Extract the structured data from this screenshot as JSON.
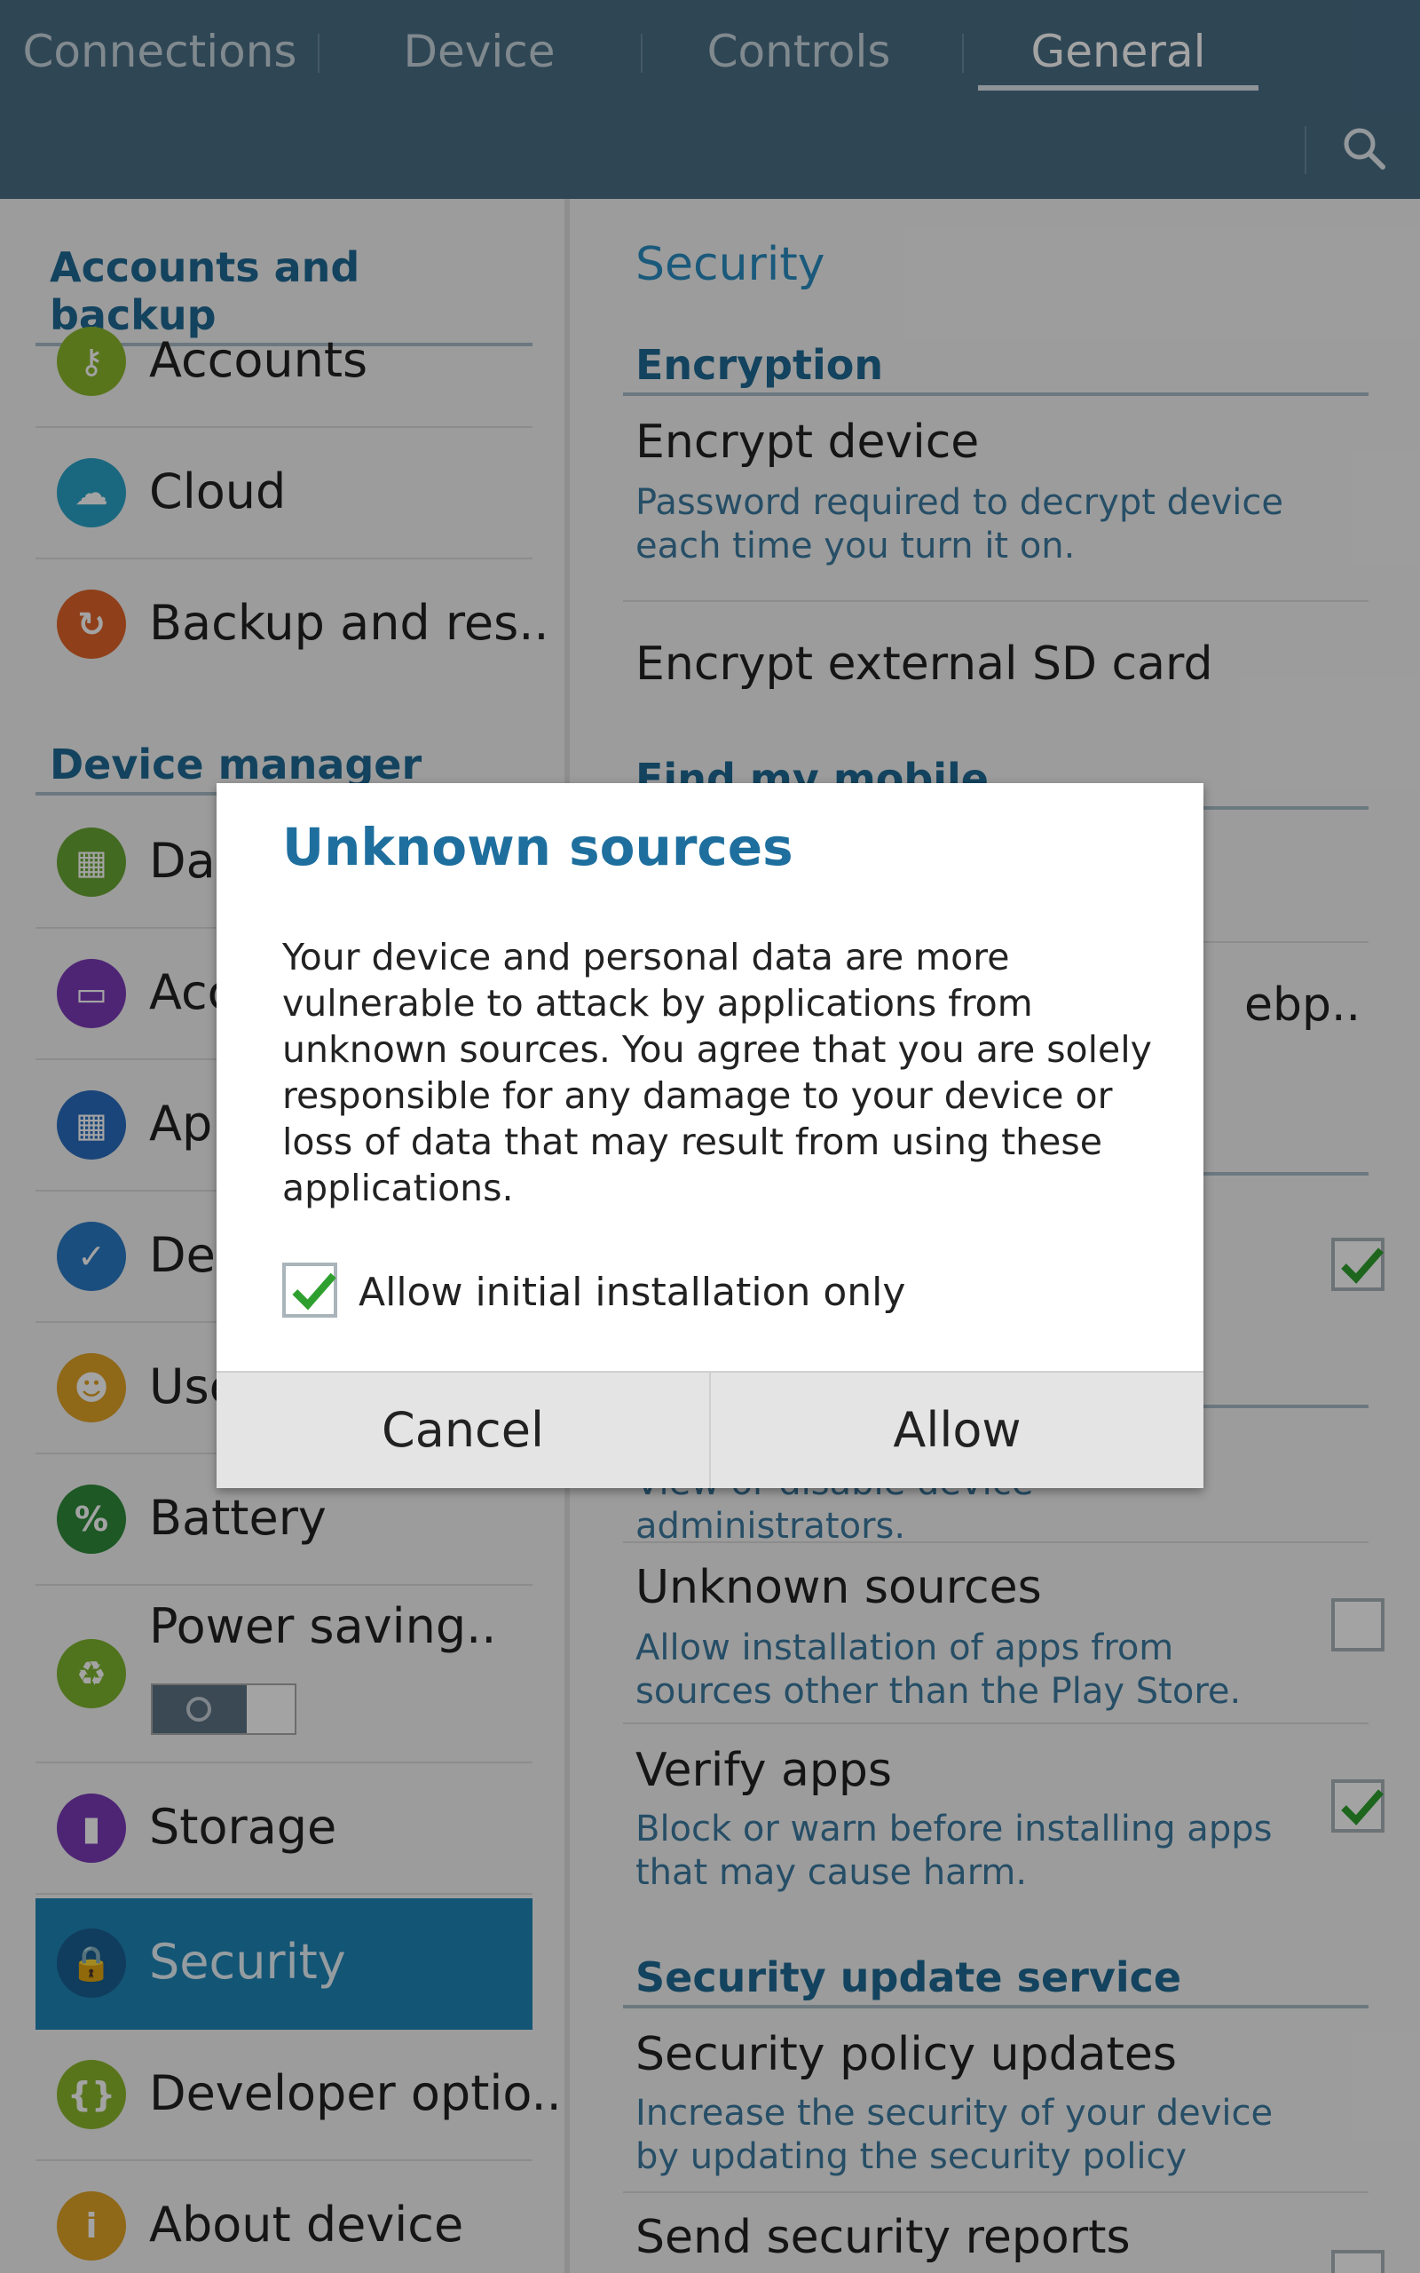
{
  "tabs": [
    "Connections",
    "Device",
    "Controls",
    "General"
  ],
  "active_tab": "General",
  "left": {
    "section1": "Accounts and backup",
    "section2": "Device manager",
    "items": [
      {
        "label": "Accounts",
        "icon": "key-icon",
        "color": "#8bb82c"
      },
      {
        "label": "Cloud",
        "icon": "cloud-sync-icon",
        "color": "#2aa3c7"
      },
      {
        "label": "Backup and res..",
        "icon": "backup-icon",
        "color": "#e0652a"
      },
      {
        "label": "Dat",
        "icon": "date-time-icon",
        "color": "#6aa734"
      },
      {
        "label": "Acc",
        "icon": "accessibility-icon",
        "color": "#7a3ab8"
      },
      {
        "label": "App",
        "icon": "apps-grid-icon",
        "color": "#2a6cbf"
      },
      {
        "label": "Def",
        "icon": "default-apps-icon",
        "color": "#2a7ac5"
      },
      {
        "label": "Use",
        "icon": "users-icon",
        "color": "#e0a327"
      },
      {
        "label": "Battery",
        "icon": "battery-icon",
        "color": "#2e8a3a"
      },
      {
        "label": "Power saving..",
        "icon": "power-saving-icon",
        "color": "#7db52e"
      },
      {
        "label": "Storage",
        "icon": "storage-icon",
        "color": "#7a3ab8"
      },
      {
        "label": "Security",
        "icon": "lock-icon",
        "color": "#1a5f94"
      },
      {
        "label": "Developer optio..",
        "icon": "developer-braces-icon",
        "color": "#8bb82c"
      },
      {
        "label": "About device",
        "icon": "info-icon",
        "color": "#e0a327"
      }
    ]
  },
  "right": {
    "title": "Security",
    "encryption_head": "Encryption",
    "encrypt_device": "Encrypt device",
    "encrypt_device_sub": "Password required to decrypt device each time you turn it on.",
    "encrypt_sd": "Encrypt external SD card",
    "find_head": "Find my mobile",
    "partial_webp": "ebp..",
    "device_admin_sub": "View or disable device administrators.",
    "unknown_sources": "Unknown sources",
    "unknown_sources_sub": "Allow installation of apps from sources other than the Play Store.",
    "verify_apps": "Verify apps",
    "verify_apps_sub": "Block or warn before installing apps that may cause harm.",
    "update_head": "Security update service",
    "policy_updates": "Security policy updates",
    "policy_updates_sub": "Increase the security of your device by updating the security policy",
    "send_reports": "Send security reports"
  },
  "dialog": {
    "title": "Unknown sources",
    "body": "Your device and personal data are more vulnerable to attack by applications from unknown sources. You agree that you are solely responsible for any damage to your device or loss of data that may result from using these applications.",
    "checkbox_label": "Allow initial installation only",
    "cancel": "Cancel",
    "allow": "Allow"
  }
}
